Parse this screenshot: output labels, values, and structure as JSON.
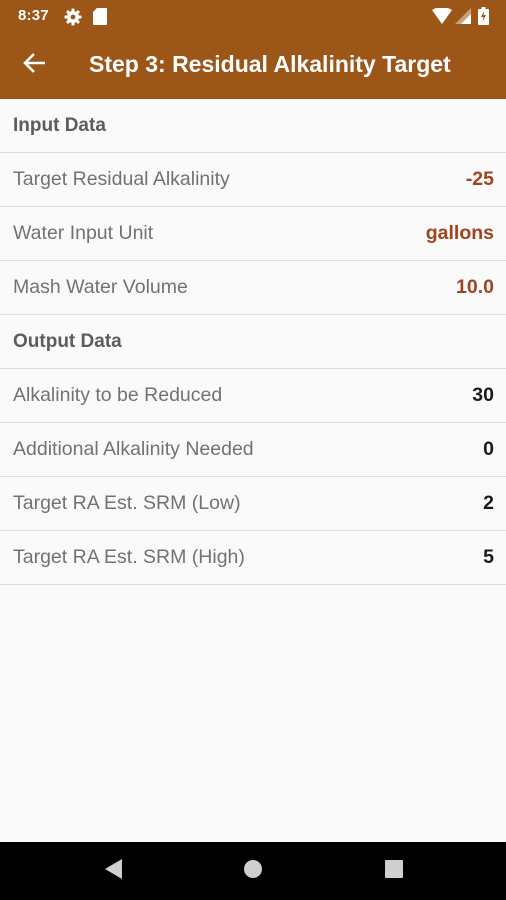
{
  "status_bar": {
    "time": "8:37",
    "icons": [
      "gear-icon",
      "sd-card-icon",
      "wifi-icon",
      "signal-icon",
      "battery-icon"
    ]
  },
  "toolbar": {
    "back_icon": "arrow-left-icon",
    "title": "Step 3: Residual Alkalinity Target",
    "background_color": "#9c5617"
  },
  "input_section": {
    "title": "Input Data",
    "rows": [
      {
        "label": "Target Residual Alkalinity",
        "value": "-25"
      },
      {
        "label": "Water Input Unit",
        "value": "gallons"
      },
      {
        "label": "Mash Water Volume",
        "value": "10.0"
      }
    ],
    "value_color": "#a0441f"
  },
  "output_section": {
    "title": "Output Data",
    "rows": [
      {
        "label": "Alkalinity to be Reduced",
        "value": "30"
      },
      {
        "label": "Additional Alkalinity Needed",
        "value": "0"
      },
      {
        "label": "Target RA Est. SRM (Low)",
        "value": "2"
      },
      {
        "label": "Target RA Est. SRM (High)",
        "value": "5"
      }
    ]
  },
  "nav_bar": {
    "buttons": [
      "back-triangle-icon",
      "home-circle-icon",
      "recents-square-icon"
    ]
  }
}
